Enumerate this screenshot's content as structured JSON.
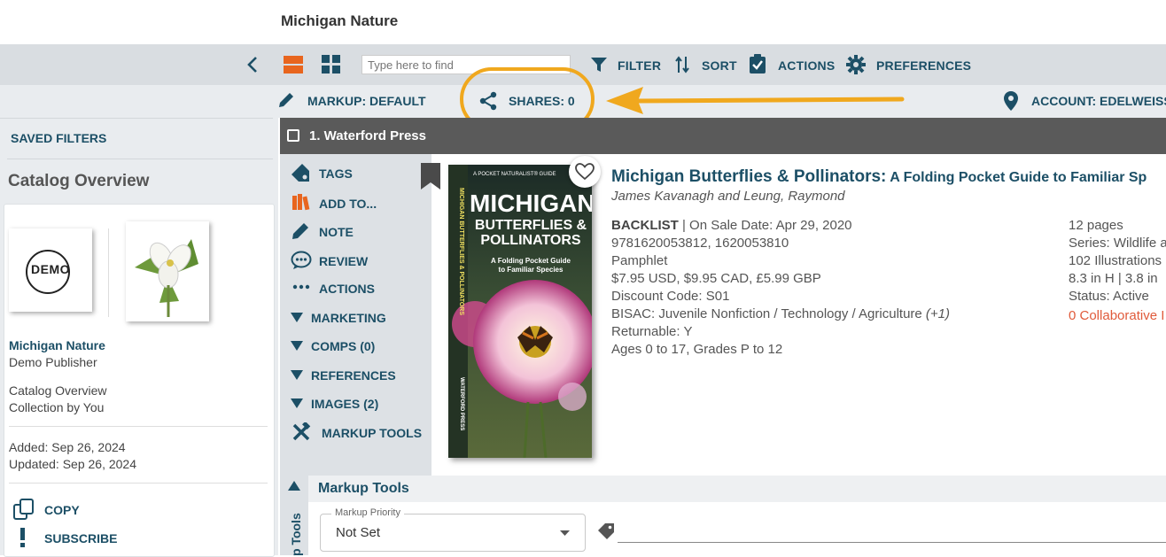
{
  "app": {
    "title": "Michigan Nature"
  },
  "toolbar": {
    "search_placeholder": "Type here to find",
    "filter_label": "FILTER",
    "sort_label": "SORT",
    "actions_label": "ACTIONS",
    "preferences_label": "PREFERENCES"
  },
  "subbar": {
    "markup_label": "MARKUP: DEFAULT",
    "shares_label": "SHARES: 0",
    "account_label": "ACCOUNT: EDELWEISS"
  },
  "sidebar": {
    "saved_filters": "SAVED FILTERS",
    "catalog_overview": "Catalog Overview",
    "logo_text": "DEMO",
    "catalog_name": "Michigan Nature",
    "publisher": "Demo Publisher",
    "type_line1": "Catalog Overview",
    "type_line2": "Collection by You",
    "added": "Added: Sep 26, 2024",
    "updated": "Updated: Sep 26, 2024",
    "copy_label": "COPY",
    "subscribe_label": "SUBSCRIBE"
  },
  "section": {
    "title": "1. Waterford Press"
  },
  "actions": {
    "tags": "TAGS",
    "add_to": "ADD TO...",
    "note": "NOTE",
    "review": "REVIEW",
    "actions": "ACTIONS",
    "marketing": "MARKETING",
    "comps": "COMPS (0)",
    "references": "REFERENCES",
    "images": "IMAGES (2)",
    "markup_tools": "MARKUP TOOLS"
  },
  "cover": {
    "top_line": "A POCKET NATURALIST® GUIDE",
    "title1": "MICHIGAN",
    "title2": "BUTTERFLIES &",
    "title3": "POLLINATORS",
    "subtitle1": "A Folding Pocket Guide",
    "subtitle2": "to Familiar Species",
    "spine": "MICHIGAN BUTTERFLIES & POLLINATORS",
    "publisher": "WATERFORD PRESS"
  },
  "product": {
    "title_main": "Michigan Butterflies & Pollinators:",
    "title_sub": " A Folding Pocket Guide to Familiar Sp",
    "authors": "James Kavanagh and Leung, Raymond",
    "backlist": "BACKLIST",
    "on_sale": " | On Sale Date: Apr 29, 2020",
    "isbn": "9781620053812, 1620053810",
    "format": "Pamphlet",
    "price": "$7.95 USD, $9.95 CAD, £5.99 GBP",
    "discount": "Discount Code: S01",
    "bisac": "BISAC: Juvenile Nonfiction / Technology / Agriculture",
    "bisac_more": " (+1)",
    "returnable": "Returnable: Y",
    "ages": "Ages 0 to 17, Grades P to 12",
    "pages": "12 pages",
    "series": "Series: Wildlife a",
    "illustrations": "102 Illustrations",
    "dimensions": "8.3 in H | 3.8 in",
    "status": "Status: Active",
    "collaborative": "0 Collaborative I"
  },
  "markup_tools": {
    "header": "Markup Tools",
    "side_label": "p Tools",
    "priority_label": "Markup Priority",
    "priority_value": "Not Set"
  },
  "colors": {
    "teal": "#1c4f66",
    "highlight": "#f0a81e",
    "orange": "#e8651e",
    "link_red": "#e05a3a"
  }
}
